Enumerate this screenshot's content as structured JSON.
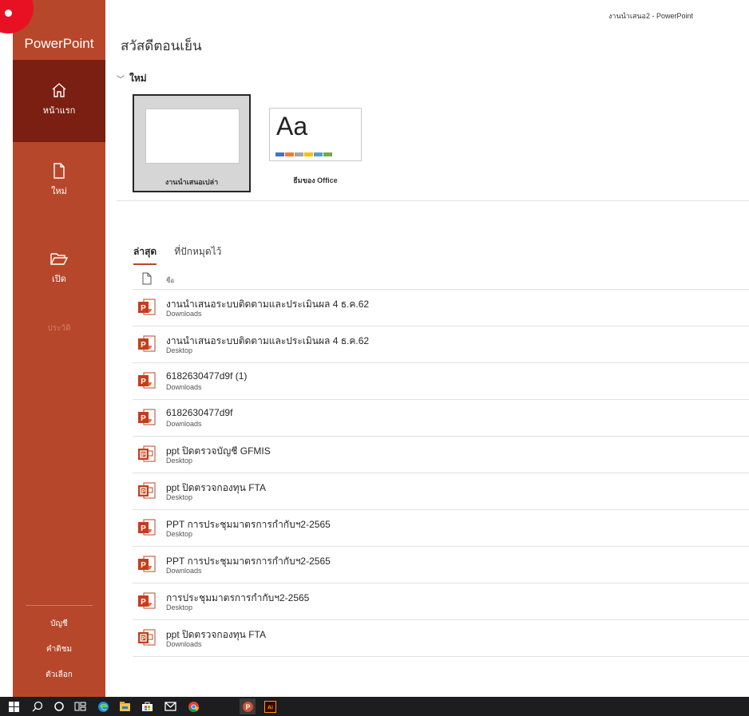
{
  "window_title": "งานนำเสนอ2  -  PowerPoint",
  "app_name": "PowerPoint",
  "greeting": "สวัสดีตอนเย็น",
  "colors": {
    "brand": "#b7472a",
    "nav_active": "#7b1f12",
    "taskbar": "#1d1d1f"
  },
  "sidebar": {
    "items": [
      {
        "label": "หน้าแรก",
        "icon": "home-icon"
      },
      {
        "label": "ใหม่",
        "icon": "new-file-icon"
      },
      {
        "label": "เปิด",
        "icon": "folder-open-icon"
      }
    ],
    "disabled_label": "ประวัติ",
    "bottom": [
      {
        "label": "บัญชี"
      },
      {
        "label": "คำติชม"
      },
      {
        "label": "ตัวเลือก"
      }
    ]
  },
  "new_section": {
    "title": "ใหม่",
    "templates": [
      {
        "label": "งานนำเสนอเปล่า"
      },
      {
        "label": "ธีมของ Office",
        "preview_text": "Aa"
      }
    ]
  },
  "tabs": [
    {
      "label": "ล่าสุด"
    },
    {
      "label": "ที่ปักหมุดไว้"
    }
  ],
  "list_header": {
    "name": "ชื่อ"
  },
  "files": [
    {
      "name": "งานนำเสนอระบบติดตามและประเมินผล 4 ธ.ค.62",
      "location": "Downloads",
      "icon": "pptx-icon"
    },
    {
      "name": "งานนำเสนอระบบติดตามและประเมินผล 4 ธ.ค.62",
      "location": "Desktop",
      "icon": "pptx-icon"
    },
    {
      "name": "6182630477d9f (1)",
      "location": "Downloads",
      "icon": "pptx-icon"
    },
    {
      "name": "6182630477d9f",
      "location": "Downloads",
      "icon": "pptx-icon"
    },
    {
      "name": "ppt ปิดตรวจบัญชี GFMIS",
      "location": "Desktop",
      "icon": "ppt-legacy-icon"
    },
    {
      "name": "ppt ปิดตรวจกองทุน FTA",
      "location": "Desktop",
      "icon": "ppt-legacy-icon"
    },
    {
      "name": "PPT การประชุมมาตรการกำกับฯ2-2565",
      "location": "Desktop",
      "icon": "pptx-icon"
    },
    {
      "name": "PPT การประชุมมาตรการกำกับฯ2-2565",
      "location": "Downloads",
      "icon": "pptx-icon"
    },
    {
      "name": "การประชุมมาตรการกำกับฯ2-2565",
      "location": "Desktop",
      "icon": "pptx-icon"
    },
    {
      "name": "ppt ปิดตรวจกองทุน FTA",
      "location": "Downloads",
      "icon": "ppt-legacy-icon"
    }
  ],
  "taskbar": [
    {
      "icon": "windows-start-icon"
    },
    {
      "icon": "search-icon"
    },
    {
      "icon": "cortana-icon"
    },
    {
      "icon": "task-view-icon"
    },
    {
      "icon": "edge-icon"
    },
    {
      "icon": "file-explorer-icon"
    },
    {
      "icon": "store-icon"
    },
    {
      "icon": "mail-icon"
    },
    {
      "icon": "chrome-icon"
    },
    {
      "icon": "powerpoint-icon"
    },
    {
      "icon": "illustrator-icon"
    }
  ]
}
